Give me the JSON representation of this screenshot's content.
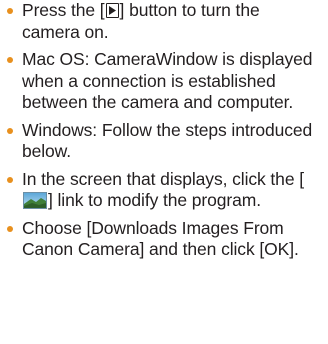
{
  "items": [
    {
      "before": "Press the [",
      "icon": "playback-button-icon",
      "after": "] button to turn the camera on."
    },
    {
      "text": "Mac OS: CameraWindow is displayed when a connection is established between the camera and computer."
    },
    {
      "text": "Windows: Follow the steps introduced below."
    },
    {
      "before": "In the screen that displays, click the [",
      "icon": "program-link-icon",
      "after": "] link to modify the program."
    },
    {
      "text": "Choose [Downloads Images From Canon Camera] and then click [OK]."
    }
  ],
  "colors": {
    "bullet": "#e8901e",
    "text": "#231f20"
  }
}
